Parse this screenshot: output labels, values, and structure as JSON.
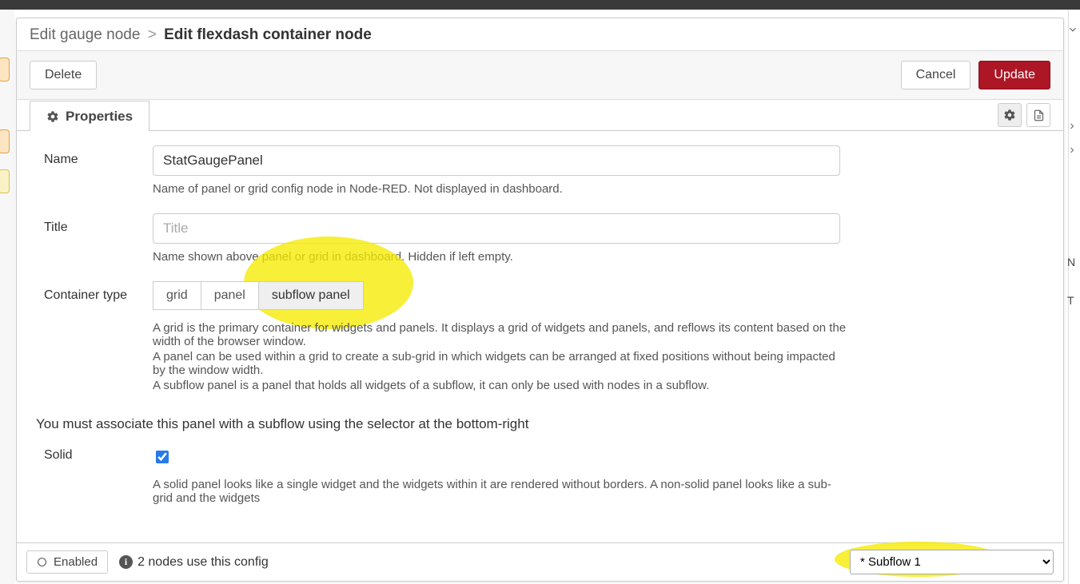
{
  "breadcrumb": {
    "parent": "Edit gauge node",
    "separator": ">",
    "current": "Edit flexdash container node"
  },
  "actions": {
    "delete": "Delete",
    "cancel": "Cancel",
    "update": "Update"
  },
  "tabs": {
    "properties": "Properties"
  },
  "fields": {
    "name": {
      "label": "Name",
      "value": "StatGaugePanel",
      "help": "Name of panel or grid config node in Node-RED. Not displayed in dashboard."
    },
    "title": {
      "label": "Title",
      "placeholder": "Title",
      "value": "",
      "help": "Name shown above panel or grid in dashboard. Hidden if left empty."
    },
    "container_type": {
      "label": "Container type",
      "options": {
        "grid": "grid",
        "panel": "panel",
        "subflow_panel": "subflow panel"
      },
      "selected": "subflow_panel",
      "help_grid": "A grid is the primary container for widgets and panels. It displays a grid of widgets and panels, and reflows its content based on the width of the browser window.",
      "help_panel": "A panel can be used within a grid to create a sub-grid in which widgets can be arranged at fixed positions without being impacted by the window width.",
      "help_subflow": "A subflow panel is a panel that holds all widgets of a subflow, it can only be used with nodes in a subflow."
    },
    "associate_notice": "You must associate this panel with a subflow using the selector at the bottom-right",
    "solid": {
      "label": "Solid",
      "checked": true,
      "help": "A solid panel looks like a single widget and the widgets within it are rendered without borders. A non-solid panel looks like a sub-grid and the widgets"
    }
  },
  "footer": {
    "enabled": "Enabled",
    "usage": "2 nodes use this config",
    "select_value": "* Subflow 1"
  },
  "right_sidebar_letters": {
    "n": "N",
    "t": "T"
  }
}
